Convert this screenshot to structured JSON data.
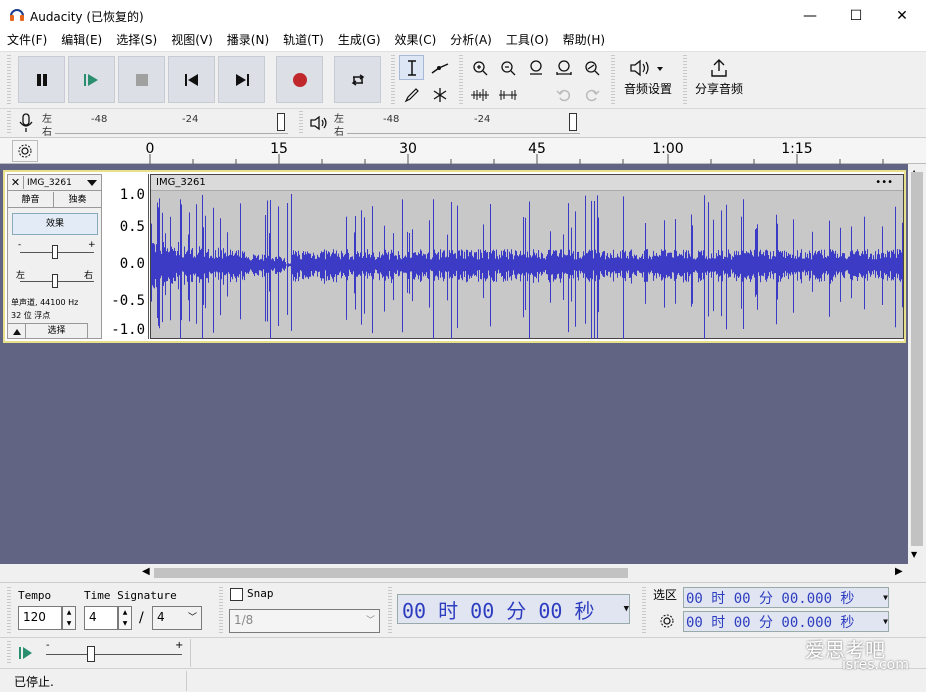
{
  "window": {
    "title": "Audacity (已恢复的)",
    "minimize": "—",
    "maximize": "☐",
    "close": "✕"
  },
  "menu": [
    "文件(F)",
    "编辑(E)",
    "选择(S)",
    "视图(V)",
    "播录(N)",
    "轨道(T)",
    "生成(G)",
    "效果(C)",
    "分析(A)",
    "工具(O)",
    "帮助(H)"
  ],
  "toolbar": {
    "audio_setup_label": "音频设置",
    "share_audio_label": "分享音频"
  },
  "meters": {
    "rec_channels": [
      "左",
      "右"
    ],
    "play_channels": [
      "左",
      "右"
    ],
    "rec_ticks": [
      "-48",
      "-24"
    ],
    "play_ticks": [
      "-48",
      "-24"
    ]
  },
  "timeline": {
    "ticks": [
      "0",
      "15",
      "30",
      "45",
      "1:00",
      "1:15"
    ]
  },
  "track": {
    "name": "IMG_3261",
    "clip_name": "IMG_3261",
    "clip_menu": "•••",
    "mute": "静音",
    "solo": "独奏",
    "effects": "效果",
    "gain_minus": "-",
    "gain_plus": "+",
    "pan_left": "左",
    "pan_right": "右",
    "info_line1": "单声道, 44100 Hz",
    "info_line2": "32 位 浮点",
    "select": "选择",
    "scale": [
      "1.0",
      "0.5",
      "0.0",
      "-0.5",
      "-1.0"
    ]
  },
  "bottom": {
    "tempo_label": "Tempo",
    "tempo_value": "120",
    "timesig_label": "Time Signature",
    "timesig_num": "4",
    "timesig_slash": "/",
    "timesig_den": "4",
    "snap_label": "Snap",
    "snap_value": "1/8",
    "time_display": "00 时 00 分 00 秒",
    "selection_label": "选区",
    "sel_start": "00 时 00 分 00.000 秒",
    "sel_end": "00 时 00 分 00.000 秒",
    "speed_minus": "-",
    "speed_plus": "+"
  },
  "status": {
    "text": "已停止."
  },
  "watermark": {
    "line1": "爱思考吧",
    "line2": "isres.com"
  },
  "colors": {
    "waveform": "#3b3bc6",
    "track_bg": "#626484",
    "record": "#c0282c"
  }
}
